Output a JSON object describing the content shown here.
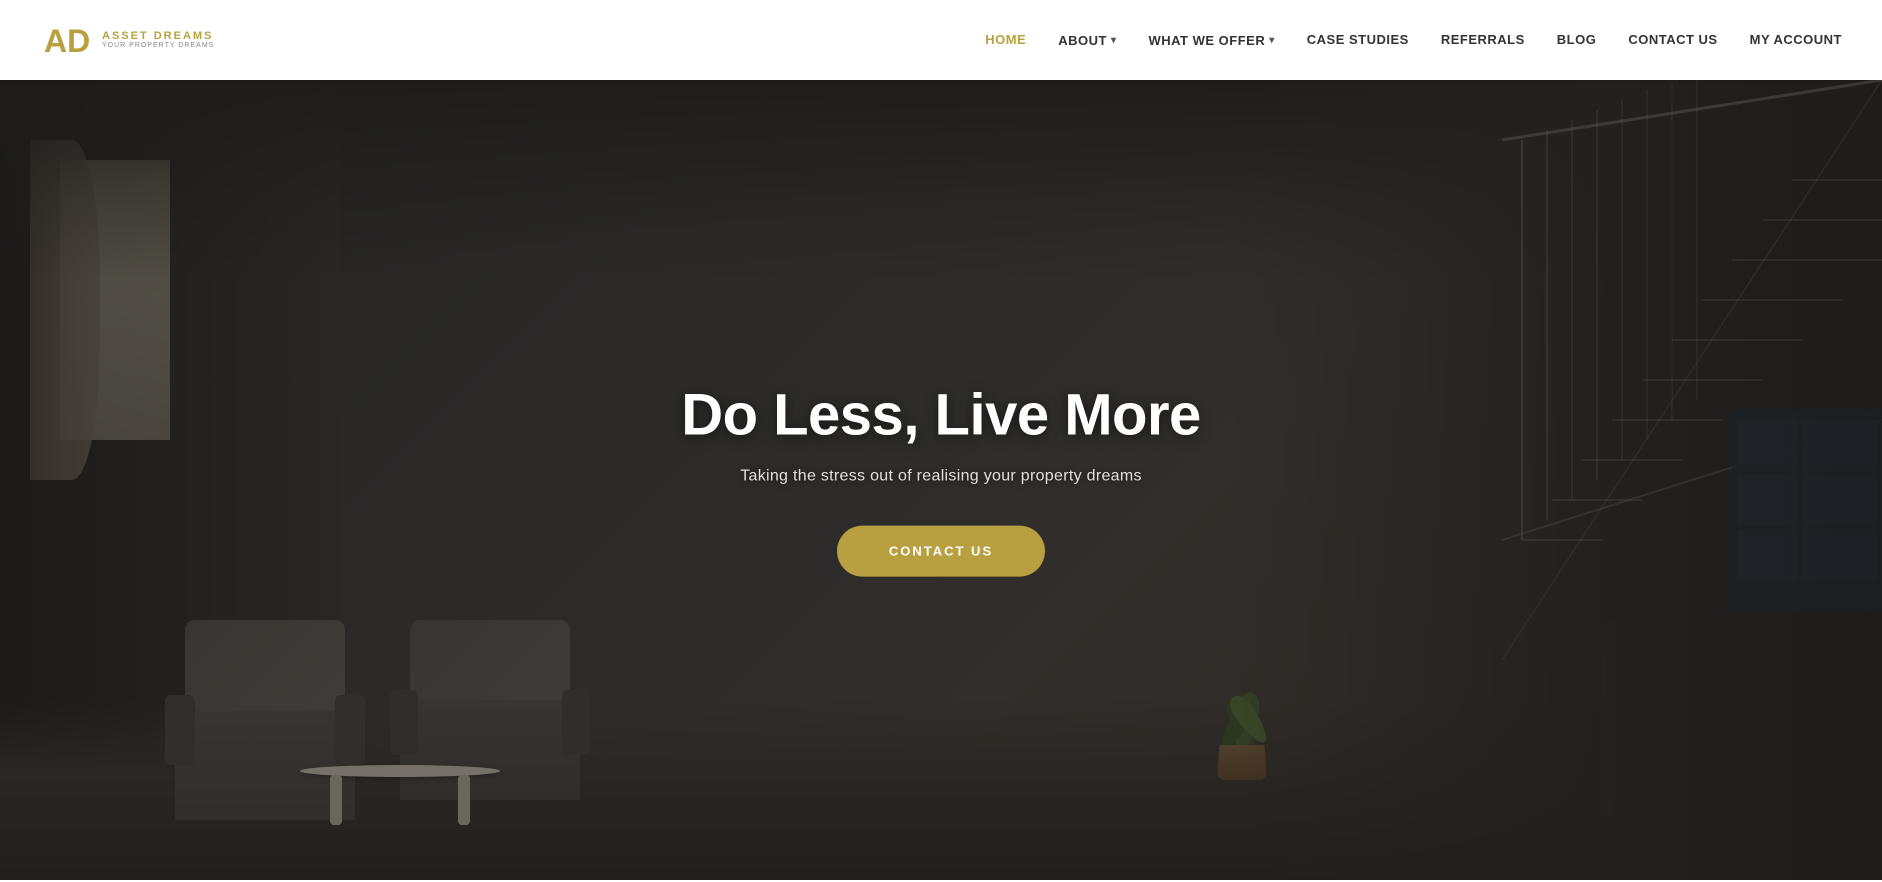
{
  "brand": {
    "name": "ASSET DREAMS",
    "tagline": "YOUR PROPERTY DREAMS",
    "logo_initials": "AD"
  },
  "nav": {
    "links": [
      {
        "id": "home",
        "label": "HOME",
        "active": true,
        "has_dropdown": false
      },
      {
        "id": "about",
        "label": "ABOUT",
        "active": false,
        "has_dropdown": true
      },
      {
        "id": "what-we-offer",
        "label": "WHAT WE OFFER",
        "active": false,
        "has_dropdown": true
      },
      {
        "id": "case-studies",
        "label": "CASE STUDIES",
        "active": false,
        "has_dropdown": false
      },
      {
        "id": "referrals",
        "label": "REFERRALS",
        "active": false,
        "has_dropdown": false
      },
      {
        "id": "blog",
        "label": "BLOG",
        "active": false,
        "has_dropdown": false
      },
      {
        "id": "contact-us",
        "label": "CONTACT US",
        "active": false,
        "has_dropdown": false
      },
      {
        "id": "my-account",
        "label": "MY ACCOUNT",
        "active": false,
        "has_dropdown": false
      }
    ]
  },
  "hero": {
    "headline": "Do Less, Live More",
    "subheadline": "Taking the stress out of realising your property dreams",
    "cta_label": "CONTACT US",
    "accent_color": "#b8a040"
  }
}
